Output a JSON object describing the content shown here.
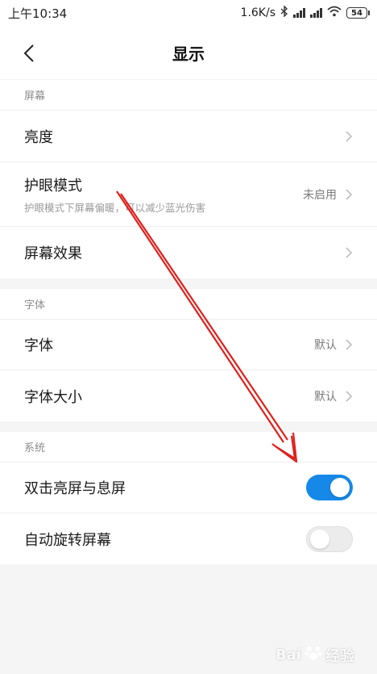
{
  "status_bar": {
    "time": "上午10:34",
    "network_speed": "1.6K/s",
    "battery": "54"
  },
  "header": {
    "title": "显示"
  },
  "sections": {
    "screen": {
      "title": "屏幕",
      "brightness": {
        "label": "亮度"
      },
      "eye_mode": {
        "label": "护眼模式",
        "subtitle": "护眼模式下屏幕偏暖，可以减少蓝光伤害",
        "value": "未启用"
      },
      "screen_effect": {
        "label": "屏幕效果"
      }
    },
    "font": {
      "title": "字体",
      "font_face": {
        "label": "字体",
        "value": "默认"
      },
      "font_size": {
        "label": "字体大小",
        "value": "默认"
      }
    },
    "system": {
      "title": "系统",
      "double_tap": {
        "label": "双击亮屏与息屏",
        "enabled": true
      },
      "auto_rotate": {
        "label": "自动旋转屏幕",
        "enabled": false
      }
    }
  },
  "colors": {
    "toggle_on": "#1588e8",
    "annotation_arrow": "#e0201c"
  },
  "watermark": {
    "brand": "Bai",
    "brand_cn": "经验"
  }
}
